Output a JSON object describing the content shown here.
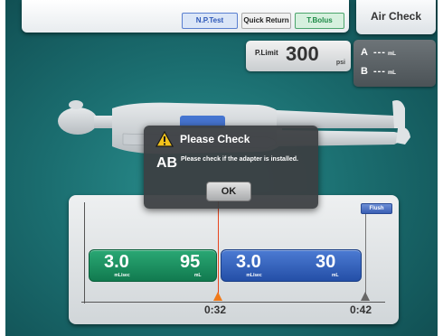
{
  "toolbar": {
    "np_test_label": "N.P.Test",
    "quick_return_label": "Quick Return",
    "t_bolus_label": "T.Bolus",
    "air_check_label": "Air Check"
  },
  "pressure_limit": {
    "label": "P.Limit",
    "value": "300",
    "unit": "psi"
  },
  "syringes": {
    "a": {
      "label": "A",
      "value": "---",
      "unit": "mL"
    },
    "b": {
      "label": "B",
      "value": "---",
      "unit": "mL"
    }
  },
  "dialog": {
    "title": "Please Check",
    "code": "AB",
    "message": "Please check if the adapter is installed.",
    "ok_label": "OK"
  },
  "timeline": {
    "flush_label": "Flush",
    "current_time": "0:32",
    "end_time": "0:42",
    "phases": [
      {
        "rate": "3.0",
        "rate_unit": "mL/sec",
        "volume": "95",
        "volume_unit": "mL",
        "color": "#1f9464"
      },
      {
        "rate": "3.0",
        "rate_unit": "mL/sec",
        "volume": "30",
        "volume_unit": "mL",
        "color": "#3566c2"
      }
    ]
  },
  "colors": {
    "background": "#1b6e70",
    "phase_a": "#1f9464",
    "phase_b": "#3566c2",
    "progress_marker": "#e8451e"
  }
}
